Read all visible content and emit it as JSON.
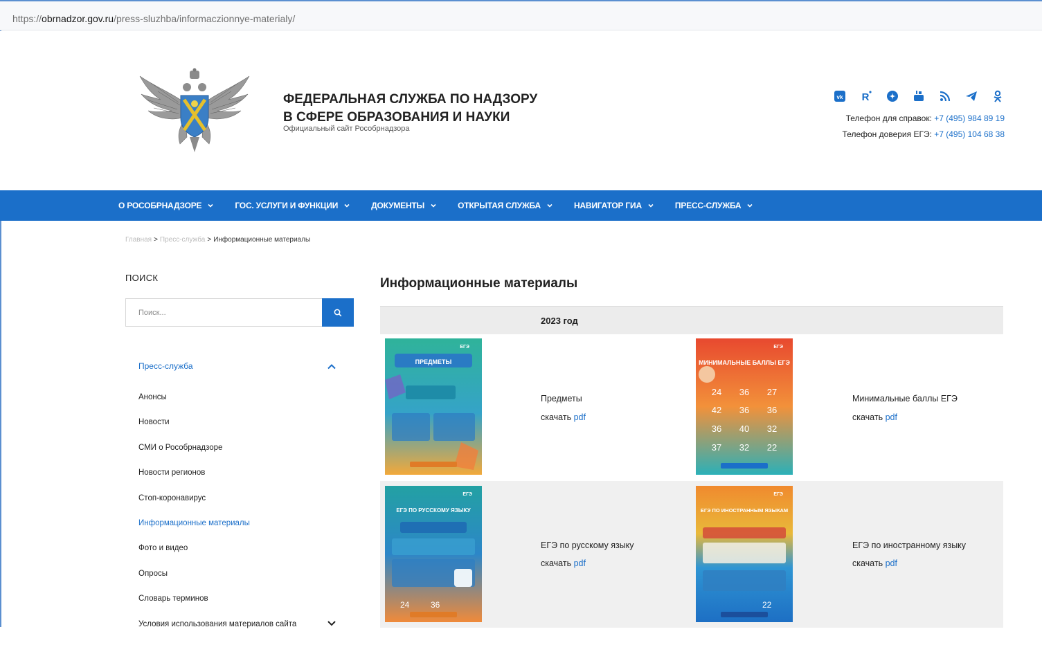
{
  "browser": {
    "url_prefix": "https://",
    "url_domain": "obrnadzor.gov.ru",
    "url_path": "/press-sluzhba/informaczionnye-materialy/"
  },
  "header": {
    "title": "ФЕДЕРАЛЬНАЯ СЛУЖБА ПО НАДЗОРУ В СФЕРЕ ОБРАЗОВАНИЯ И НАУКИ",
    "subtitle": "Официальный сайт Рособрнадзора",
    "socials": [
      "vk-icon",
      "rutube-icon",
      "dzen-icon",
      "youtube-icon",
      "rss-icon",
      "telegram-icon",
      "odnoklassniki-icon"
    ],
    "phone1_label": "Телефон для справок: ",
    "phone1_number": "+7 (495) 984 89 19",
    "phone2_label": "Телефон доверия ЕГЭ: ",
    "phone2_number": "+7 (495) 104 68 38"
  },
  "nav": {
    "items": [
      {
        "label": "О РОСОБРНАДЗОРЕ"
      },
      {
        "label": "ГОС. УСЛУГИ И ФУНКЦИИ"
      },
      {
        "label": "ДОКУМЕНТЫ"
      },
      {
        "label": "ОТКРЫТАЯ СЛУЖБА"
      },
      {
        "label": "НАВИГАТОР ГИА"
      },
      {
        "label": "ПРЕСС-СЛУЖБА"
      }
    ]
  },
  "breadcrumb": {
    "home": "Главная",
    "section": "Пресс-служба",
    "current": "Информационные материалы",
    "separator": ">"
  },
  "sidebar": {
    "search_label": "ПОИСК",
    "search_placeholder": "Поиск...",
    "section_title": "Пресс-служба",
    "items": [
      {
        "label": "Анонсы"
      },
      {
        "label": "Новости"
      },
      {
        "label": "СМИ о Рособрнадзоре"
      },
      {
        "label": "Новости регионов"
      },
      {
        "label": "Стоп-коронавирус"
      },
      {
        "label": "Информационные материалы"
      },
      {
        "label": "Фото и видео"
      },
      {
        "label": "Опросы"
      },
      {
        "label": "Словарь терминов"
      },
      {
        "label": "Условия использования материалов сайта"
      }
    ]
  },
  "main": {
    "title": "Информационные материалы",
    "year": "2023 год",
    "download_prefix": "скачать ",
    "download_link": "pdf",
    "materials": [
      {
        "title": "Предметы"
      },
      {
        "title": "Минимальные баллы ЕГЭ"
      },
      {
        "title": "ЕГЭ по русскому языку"
      },
      {
        "title": "ЕГЭ по иностранному языку"
      }
    ],
    "posters": {
      "p1": {
        "title": "ПРЕДМЕТЫ",
        "badge": "ЕГЭ"
      },
      "p2": {
        "title": "МИНИМАЛЬНЫЕ БАЛЛЫ ЕГЭ",
        "badge": "ЕГЭ",
        "scores": [
          "24",
          "36",
          "27",
          "42",
          "36",
          "36",
          "36",
          "40",
          "32",
          "37",
          "32",
          "22"
        ]
      },
      "p3": {
        "title": "ЕГЭ ПО РУССКОМУ ЯЗЫКУ",
        "badge": "ЕГЭ",
        "scores": [
          "24",
          "36"
        ]
      },
      "p4": {
        "title": "ЕГЭ ПО ИНОСТРАННЫМ ЯЗЫКАМ",
        "badge": "ЕГЭ",
        "scores": [
          "22"
        ]
      }
    }
  },
  "colors": {
    "brand_blue": "#1b6fc9"
  }
}
